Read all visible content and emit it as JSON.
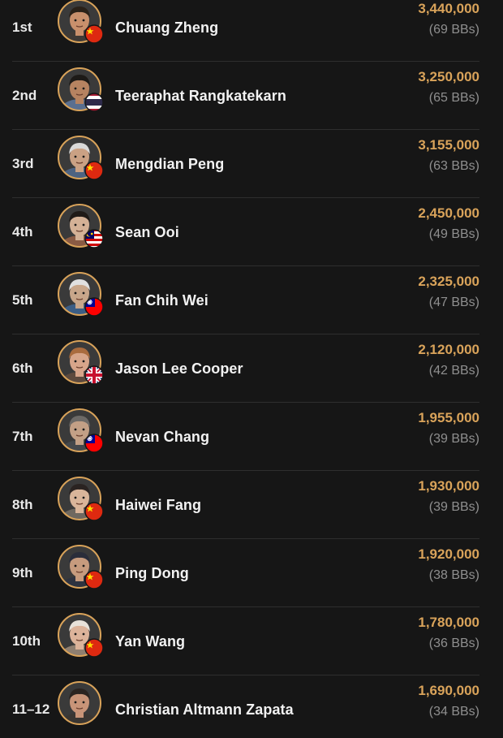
{
  "players": [
    {
      "rank": "1st",
      "name": "Chuang Zheng",
      "chips": "3,440,000",
      "bbs": "(69 BBs)",
      "flag": "china-flag-icon",
      "skin": "#c9906c",
      "hair": "#2a2118",
      "shirt": "#3f3a36"
    },
    {
      "rank": "2nd",
      "name": "Teeraphat Rangkatekarn",
      "chips": "3,250,000",
      "bbs": "(65 BBs)",
      "flag": "thailand-flag-icon",
      "skin": "#b68361",
      "hair": "#1d1a17",
      "shirt": "#5a6f90"
    },
    {
      "rank": "3rd",
      "name": "Mengdian Peng",
      "chips": "3,155,000",
      "bbs": "(63 BBs)",
      "flag": "china-flag-icon",
      "skin": "#caa184",
      "hair": "#d9d9d9",
      "shirt": "#4d6382"
    },
    {
      "rank": "4th",
      "name": "Sean Ooi",
      "chips": "2,450,000",
      "bbs": "(49 BBs)",
      "flag": "malaysia-flag-icon",
      "skin": "#d4b196",
      "hair": "#1f1a17",
      "shirt": "#8a5b44"
    },
    {
      "rank": "5th",
      "name": "Fan Chih Wei",
      "chips": "2,325,000",
      "bbs": "(47 BBs)",
      "flag": "taiwan-flag-icon",
      "skin": "#c8a68a",
      "hair": "#e0e0e0",
      "shirt": "#3c5e85"
    },
    {
      "rank": "6th",
      "name": "Jason Lee Cooper",
      "chips": "2,120,000",
      "bbs": "(42 BBs)",
      "flag": "uk-flag-icon",
      "skin": "#d7a58a",
      "hair": "#a96b3e",
      "shirt": "#5d4a3e"
    },
    {
      "rank": "7th",
      "name": "Nevan Chang",
      "chips": "1,955,000",
      "bbs": "(39 BBs)",
      "flag": "taiwan-flag-icon",
      "skin": "#c3a086",
      "hair": "#6d6a67",
      "shirt": "#44484c"
    },
    {
      "rank": "8th",
      "name": "Haiwei Fang",
      "chips": "1,930,000",
      "bbs": "(39 BBs)",
      "flag": "china-flag-icon",
      "skin": "#d9b59a",
      "hair": "#2a2321",
      "shirt": "#6e6860"
    },
    {
      "rank": "9th",
      "name": "Ping Dong",
      "chips": "1,920,000",
      "bbs": "(38 BBs)",
      "flag": "china-flag-icon",
      "skin": "#c69b7e",
      "hair": "#2a2d3a",
      "shirt": "#2e3340"
    },
    {
      "rank": "10th",
      "name": "Yan Wang",
      "chips": "1,780,000",
      "bbs": "(36 BBs)",
      "flag": "china-flag-icon",
      "skin": "#dcb39a",
      "hair": "#e8e2da",
      "shirt": "#8f7f70"
    },
    {
      "rank": "11–12",
      "name": "Christian Altmann Zapata",
      "chips": "1,690,000",
      "bbs": "(34 BBs)",
      "flag": "",
      "skin": "#c89478",
      "hair": "#2b2420",
      "shirt": "#3a3632"
    }
  ],
  "colors": {
    "background": "#161616",
    "chips": "#d9a35a",
    "bbs": "#8f8f8f",
    "avatar_ring": "#d9a35a",
    "divider": "#2e2e2e"
  }
}
